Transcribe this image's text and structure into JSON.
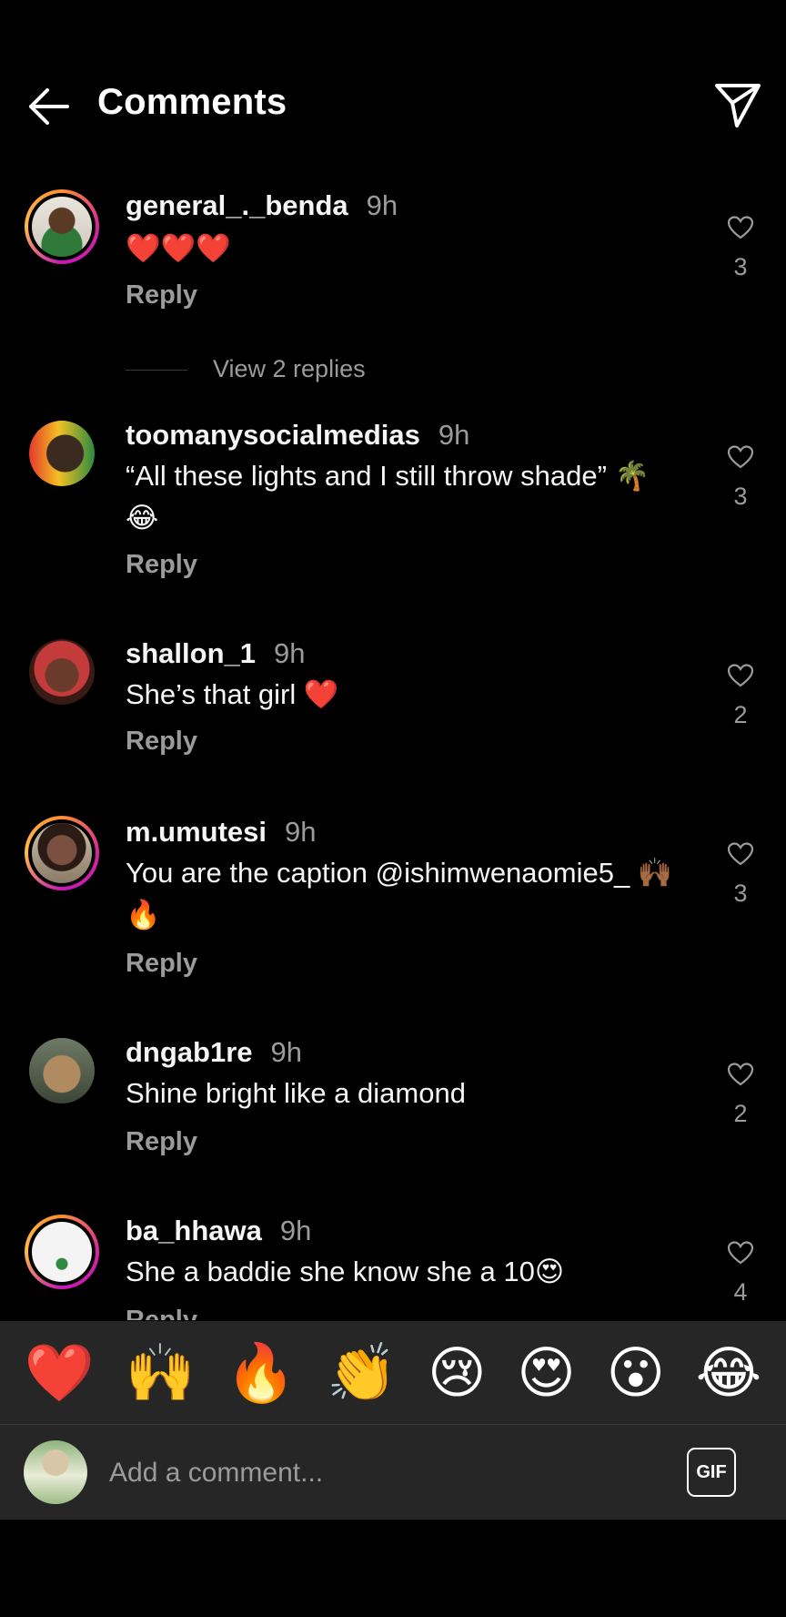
{
  "header": {
    "title": "Comments",
    "back_icon": "arrow-left-icon",
    "share_icon": "paper-plane-icon"
  },
  "comments": [
    {
      "username": "general_._benda",
      "time": "9h",
      "text": "❤️❤️❤️",
      "reply": "Reply",
      "likes": "3",
      "view_replies": "View 2 replies",
      "avatar_ring": true
    },
    {
      "username": "toomanysocialmedias",
      "time": "9h",
      "text": "“All these lights and I still throw shade” 🌴😂",
      "reply": "Reply",
      "likes": "3",
      "avatar_ring": false
    },
    {
      "username": "shallon_1",
      "time": "9h",
      "text": "She’s that girl ❤️",
      "reply": "Reply",
      "likes": "2",
      "avatar_ring": false
    },
    {
      "username": "m.umutesi",
      "time": "9h",
      "text": "You are the caption @ishimwenaomie5_ 🙌🏾🔥",
      "reply": "Reply",
      "likes": "3",
      "avatar_ring": true
    },
    {
      "username": "dngab1re",
      "time": "9h",
      "text": "Shine bright like a diamond",
      "reply": "Reply",
      "likes": "2",
      "avatar_ring": false
    },
    {
      "username": "ba_hhawa",
      "time": "9h",
      "text": "She a baddie she know she a 10😍",
      "reply": "Reply",
      "likes": "4",
      "avatar_ring": true
    }
  ],
  "reactions": [
    "❤️",
    "🙌",
    "🔥",
    "👏",
    "😢",
    "😍",
    "😮",
    "😂"
  ],
  "composer": {
    "placeholder": "Add a comment...",
    "gif_label": "GIF"
  }
}
